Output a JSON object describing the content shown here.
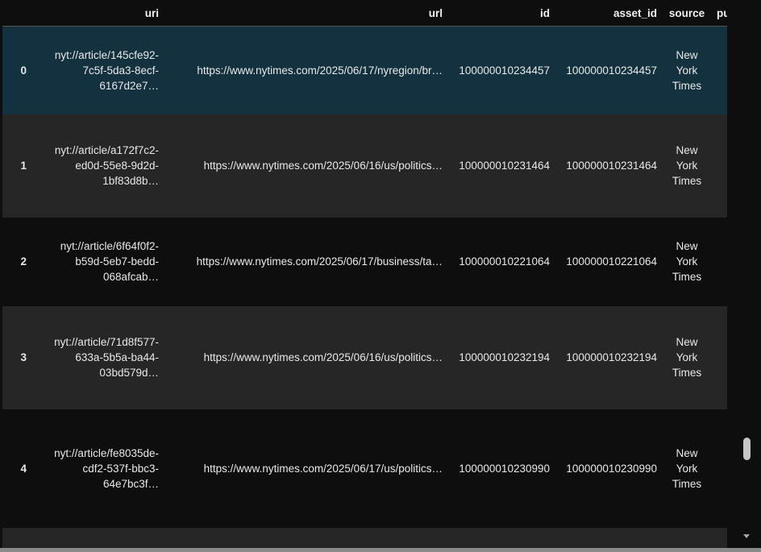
{
  "columns": {
    "index": "",
    "uri": "uri",
    "url": "url",
    "id": "id",
    "asset_id": "asset_id",
    "source": "source",
    "pub": "pul"
  },
  "rows": [
    {
      "index": "0",
      "uri_lines": [
        "nyt://article/145cfe92-",
        "7c5f-5da3-8ecf-",
        "6167d2e7…"
      ],
      "url": "https://www.nytimes.com/2025/06/17/nyregion/br…",
      "id": "100000010234457",
      "asset_id": "100000010234457",
      "source_lines": [
        "New",
        "York",
        "Times"
      ]
    },
    {
      "index": "1",
      "uri_lines": [
        "nyt://article/a172f7c2-",
        "ed0d-55e8-9d2d-",
        "1bf83d8b…"
      ],
      "url": "https://www.nytimes.com/2025/06/16/us/politics…",
      "id": "100000010231464",
      "asset_id": "100000010231464",
      "source_lines": [
        "New",
        "York",
        "Times"
      ]
    },
    {
      "index": "2",
      "uri_lines": [
        "nyt://article/6f64f0f2-",
        "b59d-5eb7-bedd-",
        "068afcab…"
      ],
      "url": "https://www.nytimes.com/2025/06/17/business/ta…",
      "id": "100000010221064",
      "asset_id": "100000010221064",
      "source_lines": [
        "New",
        "York",
        "Times"
      ]
    },
    {
      "index": "3",
      "uri_lines": [
        "nyt://article/71d8f577-",
        "633a-5b5a-ba44-",
        "03bd579d…"
      ],
      "url": "https://www.nytimes.com/2025/06/16/us/politics…",
      "id": "100000010232194",
      "asset_id": "100000010232194",
      "source_lines": [
        "New",
        "York",
        "Times"
      ]
    },
    {
      "index": "4",
      "uri_lines": [
        "nyt://article/fe8035de-",
        "cdf2-537f-bbc3-",
        "64e7bc3f…"
      ],
      "url": "https://www.nytimes.com/2025/06/17/us/politics…",
      "id": "100000010230990",
      "asset_id": "100000010230990",
      "source_lines": [
        "New",
        "York",
        "Times"
      ]
    }
  ],
  "colors": {
    "background": "#0e0e0e",
    "row_alt": "#262626",
    "row_selected": "#13313f",
    "text": "#e8e8e8"
  }
}
